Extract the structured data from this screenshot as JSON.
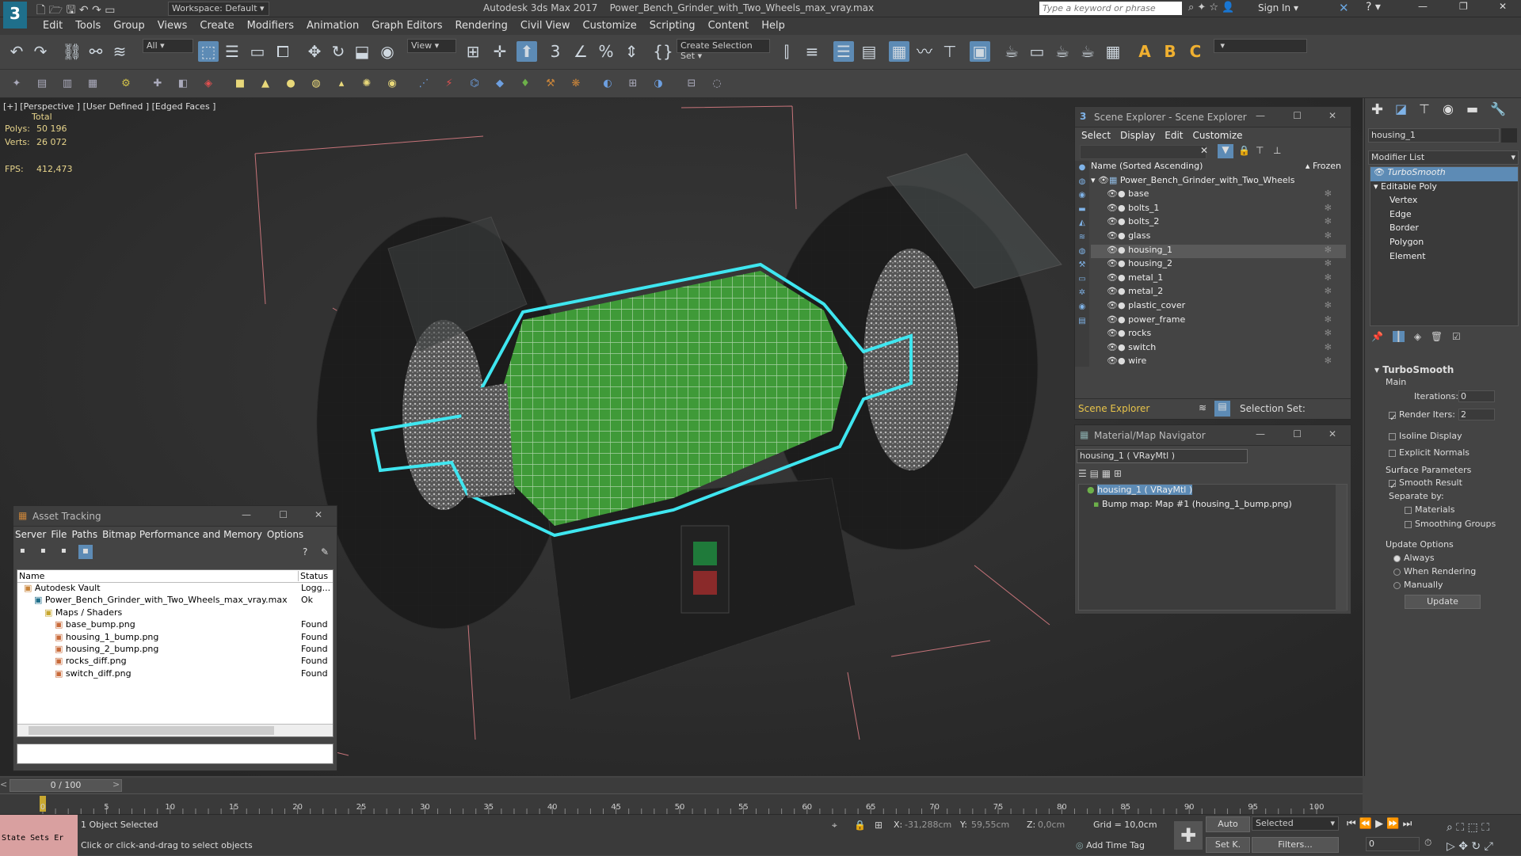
{
  "title": {
    "workspace": "Workspace: Default",
    "app": "Autodesk 3ds Max 2017",
    "file": "Power_Bench_Grinder_with_Two_Wheels_max_vray.max",
    "search_placeholder": "Type a keyword or phrase",
    "sign_in": "Sign In"
  },
  "menu": [
    "Edit",
    "Tools",
    "Group",
    "Views",
    "Create",
    "Modifiers",
    "Animation",
    "Graph Editors",
    "Rendering",
    "Civil View",
    "Customize",
    "Scripting",
    "Content",
    "Help"
  ],
  "toolbar": {
    "filter": "All",
    "view": "View",
    "selection_set": "Create Selection Set"
  },
  "viewport": {
    "label": "[+] [Perspective ] [User Defined ] [Edged Faces ]",
    "total": "Total",
    "polys_label": "Polys:",
    "polys": "50 196",
    "verts_label": "Verts:",
    "verts": "26 072",
    "fps_label": "FPS:",
    "fps": "412,473"
  },
  "scene_explorer": {
    "title": "Scene Explorer - Scene Explorer",
    "menu": [
      "Select",
      "Display",
      "Edit",
      "Customize"
    ],
    "col_name": "Name (Sorted Ascending)",
    "col_frozen": "▴ Frozen",
    "root": "Power_Bench_Grinder_with_Two_Wheels",
    "items": [
      "base",
      "bolts_1",
      "bolts_2",
      "glass",
      "housing_1",
      "housing_2",
      "metal_1",
      "metal_2",
      "plastic_cover",
      "power_frame",
      "rocks",
      "switch",
      "wire"
    ],
    "selected": "housing_1",
    "footer_label": "Scene Explorer",
    "selection_set": "Selection Set:"
  },
  "material_nav": {
    "title": "Material/Map Navigator",
    "field": "housing_1  ( VRayMtl )",
    "node": "housing_1  ( VRayMtl )",
    "child": "Bump map: Map #1 (housing_1_bump.png)"
  },
  "asset_tracking": {
    "title": "Asset Tracking",
    "menu": [
      "Server",
      "File",
      "Paths",
      "Bitmap Performance and Memory",
      "Options"
    ],
    "col_name": "Name",
    "col_status": "Status",
    "rows": [
      {
        "indent": 0,
        "name": "Autodesk Vault",
        "status": "Logg..."
      },
      {
        "indent": 1,
        "name": "Power_Bench_Grinder_with_Two_Wheels_max_vray.max",
        "status": "Ok"
      },
      {
        "indent": 2,
        "name": "Maps / Shaders",
        "status": ""
      },
      {
        "indent": 3,
        "name": "base_bump.png",
        "status": "Found"
      },
      {
        "indent": 3,
        "name": "housing_1_bump.png",
        "status": "Found"
      },
      {
        "indent": 3,
        "name": "housing_2_bump.png",
        "status": "Found"
      },
      {
        "indent": 3,
        "name": "rocks_diff.png",
        "status": "Found"
      },
      {
        "indent": 3,
        "name": "switch_diff.png",
        "status": "Found"
      }
    ]
  },
  "command_panel": {
    "object_name": "housing_1",
    "modifier_list": "Modifier List",
    "stack": [
      "TurboSmooth",
      "Editable Poly",
      "Vertex",
      "Edge",
      "Border",
      "Polygon",
      "Element"
    ],
    "rollout_title": "TurboSmooth",
    "main": "Main",
    "iterations_label": "Iterations:",
    "iterations": "0",
    "render_iters_label": "Render Iters:",
    "render_iters": "2",
    "isoline": "Isoline Display",
    "explicit_normals": "Explicit Normals",
    "surface_params": "Surface Parameters",
    "smooth_result": "Smooth Result",
    "separate_by": "Separate by:",
    "materials": "Materials",
    "smoothing_groups": "Smoothing Groups",
    "update_options": "Update Options",
    "always": "Always",
    "when_rendering": "When Rendering",
    "manually": "Manually",
    "update": "Update"
  },
  "timeline": {
    "frame": "0 / 100",
    "ticks": [
      "0",
      "5",
      "10",
      "15",
      "20",
      "25",
      "30",
      "35",
      "40",
      "45",
      "50",
      "55",
      "60",
      "65",
      "70",
      "75",
      "80",
      "85",
      "90",
      "95",
      "100"
    ]
  },
  "status": {
    "left_box": "State Sets Er",
    "selected": "1 Object Selected",
    "hint": "Click or click-and-drag to select objects",
    "x_label": "X:",
    "x": "-31,288cm",
    "y_label": "Y:",
    "y": "59,55cm",
    "z_label": "Z:",
    "z": "0,0cm",
    "grid": "Grid = 10,0cm",
    "add_time_tag": "Add Time Tag",
    "auto": "Auto",
    "set_k": "Set K.",
    "selected_drop": "Selected",
    "filters": "Filters...",
    "frame_field": "0"
  },
  "colors": {
    "selection_blue": "#5d8bb5",
    "wire_cyan": "#3fe6f0",
    "housing_green": "#3f9a38",
    "stat_yellow": "#e7d48b"
  }
}
